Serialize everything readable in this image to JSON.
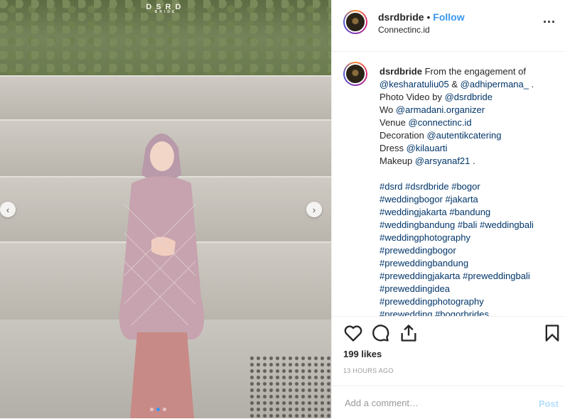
{
  "photo": {
    "brand_main": "DSRD",
    "brand_sub": "BRIDE",
    "prev_icon": "chevron-left-icon",
    "next_icon": "chevron-right-icon",
    "carousel_dots": 3,
    "active_dot": 1
  },
  "header": {
    "username": "dsrdbride",
    "separator": "•",
    "follow_label": "Follow",
    "location": "Connectinc.id",
    "more_icon": "ellipsis-icon",
    "more_label": "..."
  },
  "caption": {
    "username": "dsrdbride",
    "lines": [
      [
        {
          "t": "From the engagement of",
          "link": false
        }
      ],
      [
        {
          "t": "@kesharatuliu05",
          "link": true
        },
        {
          "t": " & ",
          "link": false
        },
        {
          "t": "@adhipermana_",
          "link": true
        },
        {
          "t": " .",
          "link": false
        }
      ],
      [
        {
          "t": "Photo Video by ",
          "link": false
        },
        {
          "t": "@dsrdbride",
          "link": true
        }
      ],
      [
        {
          "t": "Wo ",
          "link": false
        },
        {
          "t": "@armadani.organizer",
          "link": true
        }
      ],
      [
        {
          "t": "Venue ",
          "link": false
        },
        {
          "t": "@connectinc.id",
          "link": true
        }
      ],
      [
        {
          "t": "Decoration ",
          "link": false
        },
        {
          "t": "@autentikcatering",
          "link": true
        }
      ],
      [
        {
          "t": "Dress ",
          "link": false
        },
        {
          "t": "@kilauarti",
          "link": true
        }
      ],
      [
        {
          "t": "Makeup ",
          "link": false
        },
        {
          "t": "@arsyanaf21",
          "link": true
        },
        {
          "t": " .",
          "link": false
        }
      ],
      [],
      [
        {
          "t": "#dsrd",
          "link": true
        },
        {
          "t": " ",
          "link": false
        },
        {
          "t": "#dsrdbride",
          "link": true
        },
        {
          "t": " ",
          "link": false
        },
        {
          "t": "#bogor",
          "link": true
        }
      ],
      [
        {
          "t": "#weddingbogor",
          "link": true
        },
        {
          "t": " ",
          "link": false
        },
        {
          "t": "#jakarta",
          "link": true
        }
      ],
      [
        {
          "t": "#weddingjakarta",
          "link": true
        },
        {
          "t": " ",
          "link": false
        },
        {
          "t": "#bandung",
          "link": true
        }
      ],
      [
        {
          "t": "#weddingbandung",
          "link": true
        },
        {
          "t": " ",
          "link": false
        },
        {
          "t": "#bali",
          "link": true
        },
        {
          "t": " ",
          "link": false
        },
        {
          "t": "#weddingbali",
          "link": true
        }
      ],
      [
        {
          "t": "#weddingphotography",
          "link": true
        }
      ],
      [
        {
          "t": "#preweddingbogor",
          "link": true
        }
      ],
      [
        {
          "t": "#preweddingbandung",
          "link": true
        }
      ],
      [
        {
          "t": "#preweddingjakarta",
          "link": true
        },
        {
          "t": " ",
          "link": false
        },
        {
          "t": "#preweddingbali",
          "link": true
        }
      ],
      [
        {
          "t": "#preweddingidea",
          "link": true
        }
      ],
      [
        {
          "t": "#preweddingphotography",
          "link": true
        }
      ],
      [
        {
          "t": "#prewedding",
          "link": true
        },
        {
          "t": " ",
          "link": false
        },
        {
          "t": "#bogorbrides",
          "link": true
        }
      ]
    ]
  },
  "actions": {
    "like_icon": "heart-icon",
    "comment_icon": "comment-icon",
    "share_icon": "share-icon",
    "save_icon": "bookmark-icon"
  },
  "likes_label": "199 likes",
  "time_label": "13 HOURS AGO",
  "add_comment": {
    "placeholder": "Add a comment…",
    "post_label": "Post"
  },
  "colors": {
    "link": "#003569",
    "follow": "#3897f0",
    "post_disabled": "#b2dffc",
    "text": "#262626",
    "muted": "#999999"
  }
}
